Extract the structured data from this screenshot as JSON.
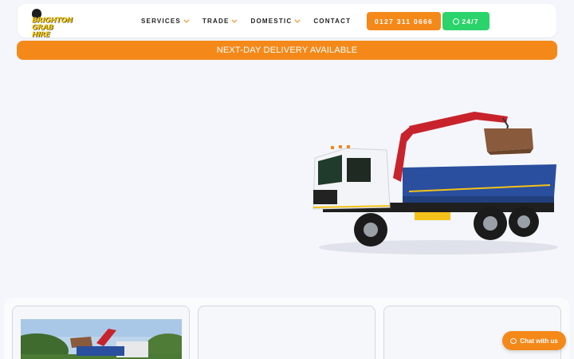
{
  "header": {
    "logo": {
      "line1": "BRIGHTON",
      "line2": "GRAB HIRE",
      "icon": "bolt-logo-icon"
    },
    "nav": [
      {
        "label": "SERVICES",
        "has_dropdown": true
      },
      {
        "label": "TRADE",
        "has_dropdown": true
      },
      {
        "label": "DOMESTIC",
        "has_dropdown": true
      },
      {
        "label": "CONTACT",
        "has_dropdown": false
      }
    ],
    "phone_label": "0127 311 0666",
    "whatsapp_label": "24/7",
    "whatsapp_icon": "whatsapp-icon"
  },
  "banner": {
    "text": "NEXT-DAY DELIVERY AVAILABLE"
  },
  "chat": {
    "label": "Chat with us",
    "icon": "chat-bubble-icon"
  },
  "colors": {
    "accent": "#f4891a",
    "whatsapp": "#2bd36b",
    "background": "#f4f6fb"
  }
}
